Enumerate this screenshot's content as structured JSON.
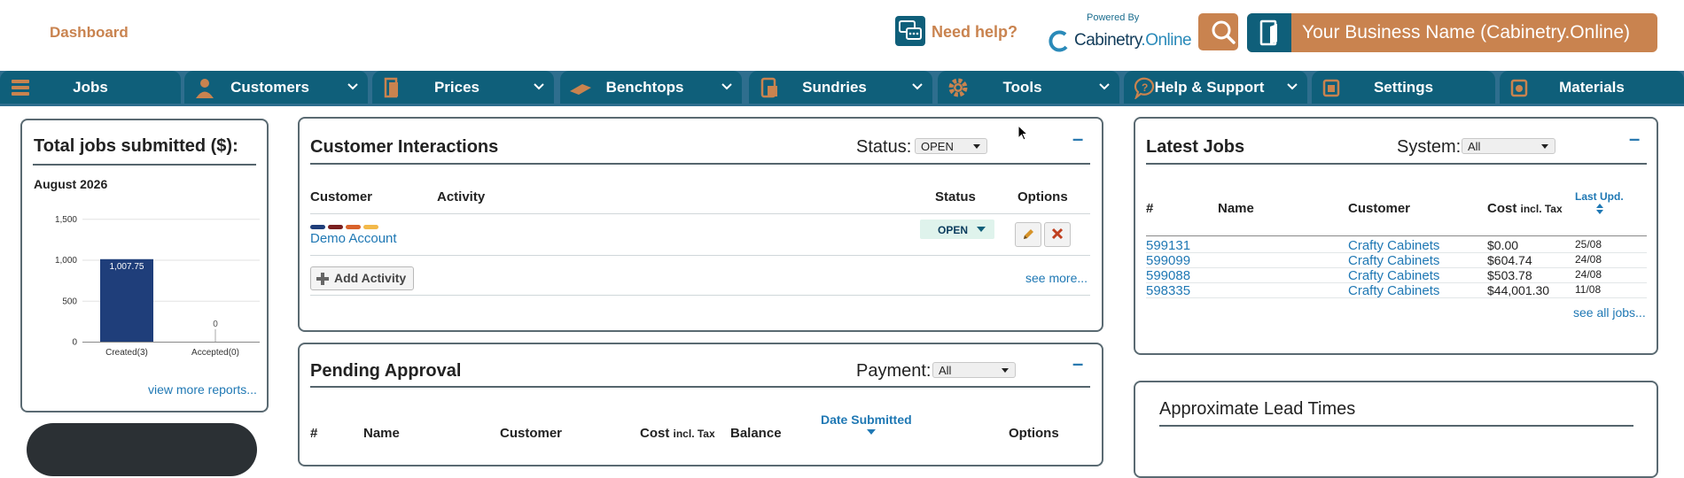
{
  "header": {
    "dashboard": "Dashboard",
    "help": "Need help?",
    "powered_by": "Powered By",
    "logo_main": "Cabinetry",
    "logo_dot": ".",
    "logo_suffix": "Online",
    "business_name": "Your Business Name (Cabinetry.Online)"
  },
  "nav": {
    "tabs": [
      {
        "label": "Jobs",
        "icon": "jobs-icon",
        "dropdown": false
      },
      {
        "label": "Customers",
        "icon": "customer-icon",
        "dropdown": true
      },
      {
        "label": "Prices",
        "icon": "prices-icon",
        "dropdown": true
      },
      {
        "label": "Benchtops",
        "icon": "benchtop-icon",
        "dropdown": true
      },
      {
        "label": "Sundries",
        "icon": "sundries-icon",
        "dropdown": true
      },
      {
        "label": "Tools",
        "icon": "gear-icon",
        "dropdown": true
      },
      {
        "label": "Help & Support",
        "icon": "help-icon",
        "dropdown": true
      },
      {
        "label": "Settings",
        "icon": "settings-icon",
        "dropdown": false
      },
      {
        "label": "Materials",
        "icon": "materials-icon",
        "dropdown": false
      }
    ]
  },
  "total_jobs": {
    "title": "Total jobs submitted ($):",
    "month": "August 2026",
    "view_more": "view more reports...",
    "chart_data": {
      "type": "bar",
      "categories": [
        "Created(3)",
        "Accepted(0)"
      ],
      "values": [
        1007.75,
        0
      ],
      "value_labels": [
        "1,007.75",
        "0"
      ],
      "yticks": [
        "0",
        "500",
        "1,000",
        "1,500"
      ],
      "ytick_values": [
        0,
        500,
        1000,
        1500
      ],
      "ylim": [
        0,
        1600
      ],
      "bar_color": "#1f3e7a"
    }
  },
  "interactions": {
    "title": "Customer Interactions",
    "status_label": "Status:",
    "status_value": "OPEN",
    "columns": [
      "Customer",
      "Activity",
      "Status",
      "Options"
    ],
    "row": {
      "customer": "Demo Account",
      "status": "OPEN",
      "tag_colors": [
        "#1f3e7a",
        "#7a1f1f",
        "#d9622b",
        "#f3b94a"
      ]
    },
    "add_activity": "Add Activity",
    "see_more": "see more..."
  },
  "pending": {
    "title": "Pending Approval",
    "payment_label": "Payment:",
    "payment_value": "All",
    "columns": {
      "num": "#",
      "name": "Name",
      "customer": "Customer",
      "cost": "Cost",
      "cost_suffix": "incl. Tax",
      "balance": "Balance",
      "date": "Date Submitted",
      "options": "Options"
    }
  },
  "latest_jobs": {
    "title": "Latest Jobs",
    "system_label": "System:",
    "system_value": "All",
    "columns": {
      "num": "#",
      "name": "Name",
      "customer": "Customer",
      "cost": "Cost",
      "cost_suffix": "incl. Tax",
      "last_upd": "Last Upd."
    },
    "rows": [
      {
        "id": "599131",
        "customer": "Crafty Cabinets",
        "cost": "$0.00",
        "date": "25/08"
      },
      {
        "id": "599099",
        "customer": "Crafty Cabinets",
        "cost": "$604.74",
        "date": "24/08"
      },
      {
        "id": "599088",
        "customer": "Crafty Cabinets",
        "cost": "$503.78",
        "date": "24/08"
      },
      {
        "id": "598335",
        "customer": "Crafty Cabinets",
        "cost": "$44,001.30",
        "date": "11/08"
      }
    ],
    "see_all": "see all jobs..."
  },
  "lead_times": {
    "title": "Approximate Lead Times"
  },
  "colors": {
    "accent": "#c9834f",
    "nav": "#0f5f7a",
    "link": "#1f78b4"
  }
}
